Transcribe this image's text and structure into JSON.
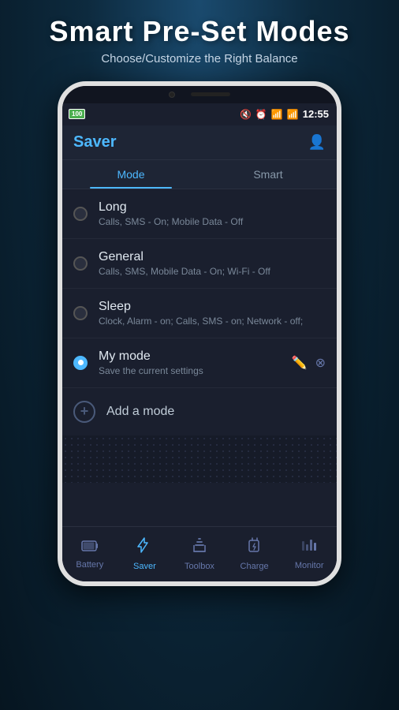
{
  "header": {
    "title": "Smart Pre-Set Modes",
    "subtitle": "Choose/Customize the Right Balance"
  },
  "phone": {
    "status_bar": {
      "battery": "100",
      "time": "12:55"
    },
    "app": {
      "title": "Saver",
      "tabs": [
        {
          "label": "Mode",
          "active": true
        },
        {
          "label": "Smart",
          "active": false
        }
      ],
      "modes": [
        {
          "id": "long",
          "name": "Long",
          "description": "Calls, SMS - On; Mobile Data - Off",
          "active": false
        },
        {
          "id": "general",
          "name": "General",
          "description": "Calls, SMS, Mobile Data - On; Wi-Fi - Off",
          "active": false
        },
        {
          "id": "sleep",
          "name": "Sleep",
          "description": "Clock, Alarm - on; Calls, SMS - on; Network - off;",
          "active": false
        },
        {
          "id": "my-mode",
          "name": "My mode",
          "description": "Save the current settings",
          "active": true
        }
      ],
      "add_mode_label": "Add a mode"
    },
    "bottom_nav": [
      {
        "id": "battery",
        "label": "Battery",
        "active": false,
        "icon": "🔋"
      },
      {
        "id": "saver",
        "label": "Saver",
        "active": true,
        "icon": "⚡"
      },
      {
        "id": "toolbox",
        "label": "Toolbox",
        "active": false,
        "icon": "🔧"
      },
      {
        "id": "charge",
        "label": "Charge",
        "active": false,
        "icon": "🔌"
      },
      {
        "id": "monitor",
        "label": "Monitor",
        "active": false,
        "icon": "📊"
      }
    ]
  }
}
